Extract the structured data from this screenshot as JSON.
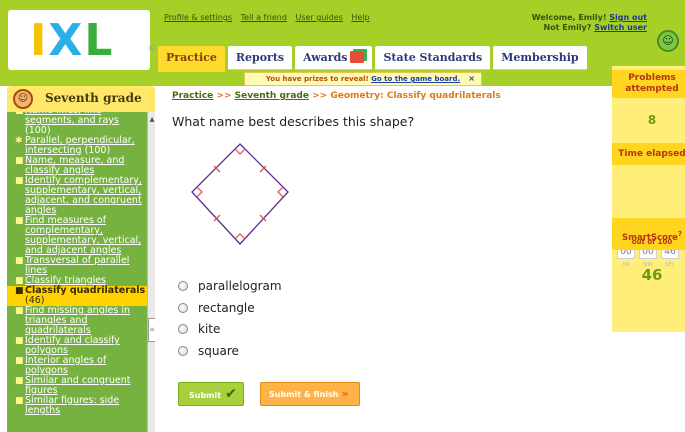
{
  "brand": {
    "logo_text": "IXL",
    "logo_letters": [
      "I",
      "X",
      "L"
    ],
    "reg_mark": "®"
  },
  "top_links": [
    "Profile & settings",
    "Tell a friend",
    "User guides",
    "Help"
  ],
  "welcome": {
    "line1": "Welcome, Emily!",
    "signout": "Sign out",
    "line2": "Not Emily?",
    "switch": "Switch user"
  },
  "tabs": [
    "Practice",
    "Reports",
    "Awards",
    "State Standards",
    "Membership"
  ],
  "active_tab": "Practice",
  "prize_banner": {
    "text": "You have prizes to reveal!",
    "link": "Go to the game board.",
    "close": "×"
  },
  "sidebar": {
    "grade": "Seventh grade",
    "skills": [
      {
        "bullet": "■",
        "name": "Name lines, line segments, and rays",
        "score": "(100)",
        "current": false
      },
      {
        "bullet": "✱",
        "name": "Parallel, perpendicular, intersecting",
        "score": "(100)",
        "current": false
      },
      {
        "bullet": "■",
        "name": "Name, measure, and classify angles",
        "score": "",
        "current": false
      },
      {
        "bullet": "■",
        "name": "Identify complementary, supplementary, vertical, adjacent, and congruent angles",
        "score": "",
        "current": false
      },
      {
        "bullet": "■",
        "name": "Find measures of complementary, supplementary, vertical, and adjacent angles",
        "score": "",
        "current": false
      },
      {
        "bullet": "■",
        "name": "Transversal of parallel lines",
        "score": "",
        "current": false
      },
      {
        "bullet": "■",
        "name": "Classify triangles",
        "score": "",
        "current": false
      },
      {
        "bullet": "■",
        "name": "Classify quadrilaterals",
        "score": "(46)",
        "current": true
      },
      {
        "bullet": "■",
        "name": "Find missing angles in triangles and quadrilaterals",
        "score": "",
        "current": false
      },
      {
        "bullet": "■",
        "name": "Identify and classify polygons",
        "score": "",
        "current": false
      },
      {
        "bullet": "■",
        "name": "Interior angles of polygons",
        "score": "",
        "current": false
      },
      {
        "bullet": "■",
        "name": "Similar and congruent figures",
        "score": "",
        "current": false
      },
      {
        "bullet": "■",
        "name": "Similar figures: side lengths",
        "score": "",
        "current": false
      }
    ]
  },
  "breadcrumb": {
    "link1": "Practice",
    "link2": "Seventh grade",
    "current": "Geometry: Classify quadrilaterals",
    "sep": ">>"
  },
  "question": "What name best describes this shape?",
  "choices": [
    "parallelogram",
    "rectangle",
    "kite",
    "square"
  ],
  "buttons": {
    "submit": "Submit",
    "submit_finish": "Submit & finish"
  },
  "stats": {
    "problems_label_1": "Problems",
    "problems_label_2": "attempted",
    "problems_value": "8",
    "time_label": "Time elapsed",
    "time_hr": "00",
    "time_min": "00",
    "time_sec": "46",
    "time_hr_label": "HR",
    "time_min_label": "MIN",
    "time_sec_label": "SEC",
    "smartscore_label": "SmartScore",
    "smartscore_help": "?",
    "smartscore_sub": "out of 100",
    "smartscore_value": "46"
  },
  "colors": {
    "header_green": "#a6cf28",
    "sidebar_green": "#76b240",
    "current_skill": "#ffd200",
    "panel_yellow": "#ffef7a",
    "shape_stroke": "#5b2d91",
    "tick_color": "#e74c3c"
  }
}
